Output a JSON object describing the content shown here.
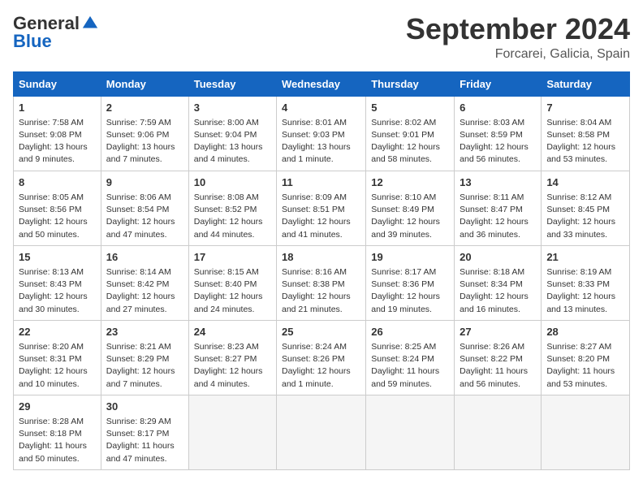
{
  "logo": {
    "general": "General",
    "blue": "Blue"
  },
  "title": "September 2024",
  "subtitle": "Forcarei, Galicia, Spain",
  "days_header": [
    "Sunday",
    "Monday",
    "Tuesday",
    "Wednesday",
    "Thursday",
    "Friday",
    "Saturday"
  ],
  "weeks": [
    [
      {
        "day": "1",
        "info": "Sunrise: 7:58 AM\nSunset: 9:08 PM\nDaylight: 13 hours and 9 minutes."
      },
      {
        "day": "2",
        "info": "Sunrise: 7:59 AM\nSunset: 9:06 PM\nDaylight: 13 hours and 7 minutes."
      },
      {
        "day": "3",
        "info": "Sunrise: 8:00 AM\nSunset: 9:04 PM\nDaylight: 13 hours and 4 minutes."
      },
      {
        "day": "4",
        "info": "Sunrise: 8:01 AM\nSunset: 9:03 PM\nDaylight: 13 hours and 1 minute."
      },
      {
        "day": "5",
        "info": "Sunrise: 8:02 AM\nSunset: 9:01 PM\nDaylight: 12 hours and 58 minutes."
      },
      {
        "day": "6",
        "info": "Sunrise: 8:03 AM\nSunset: 8:59 PM\nDaylight: 12 hours and 56 minutes."
      },
      {
        "day": "7",
        "info": "Sunrise: 8:04 AM\nSunset: 8:58 PM\nDaylight: 12 hours and 53 minutes."
      }
    ],
    [
      {
        "day": "8",
        "info": "Sunrise: 8:05 AM\nSunset: 8:56 PM\nDaylight: 12 hours and 50 minutes."
      },
      {
        "day": "9",
        "info": "Sunrise: 8:06 AM\nSunset: 8:54 PM\nDaylight: 12 hours and 47 minutes."
      },
      {
        "day": "10",
        "info": "Sunrise: 8:08 AM\nSunset: 8:52 PM\nDaylight: 12 hours and 44 minutes."
      },
      {
        "day": "11",
        "info": "Sunrise: 8:09 AM\nSunset: 8:51 PM\nDaylight: 12 hours and 41 minutes."
      },
      {
        "day": "12",
        "info": "Sunrise: 8:10 AM\nSunset: 8:49 PM\nDaylight: 12 hours and 39 minutes."
      },
      {
        "day": "13",
        "info": "Sunrise: 8:11 AM\nSunset: 8:47 PM\nDaylight: 12 hours and 36 minutes."
      },
      {
        "day": "14",
        "info": "Sunrise: 8:12 AM\nSunset: 8:45 PM\nDaylight: 12 hours and 33 minutes."
      }
    ],
    [
      {
        "day": "15",
        "info": "Sunrise: 8:13 AM\nSunset: 8:43 PM\nDaylight: 12 hours and 30 minutes."
      },
      {
        "day": "16",
        "info": "Sunrise: 8:14 AM\nSunset: 8:42 PM\nDaylight: 12 hours and 27 minutes."
      },
      {
        "day": "17",
        "info": "Sunrise: 8:15 AM\nSunset: 8:40 PM\nDaylight: 12 hours and 24 minutes."
      },
      {
        "day": "18",
        "info": "Sunrise: 8:16 AM\nSunset: 8:38 PM\nDaylight: 12 hours and 21 minutes."
      },
      {
        "day": "19",
        "info": "Sunrise: 8:17 AM\nSunset: 8:36 PM\nDaylight: 12 hours and 19 minutes."
      },
      {
        "day": "20",
        "info": "Sunrise: 8:18 AM\nSunset: 8:34 PM\nDaylight: 12 hours and 16 minutes."
      },
      {
        "day": "21",
        "info": "Sunrise: 8:19 AM\nSunset: 8:33 PM\nDaylight: 12 hours and 13 minutes."
      }
    ],
    [
      {
        "day": "22",
        "info": "Sunrise: 8:20 AM\nSunset: 8:31 PM\nDaylight: 12 hours and 10 minutes."
      },
      {
        "day": "23",
        "info": "Sunrise: 8:21 AM\nSunset: 8:29 PM\nDaylight: 12 hours and 7 minutes."
      },
      {
        "day": "24",
        "info": "Sunrise: 8:23 AM\nSunset: 8:27 PM\nDaylight: 12 hours and 4 minutes."
      },
      {
        "day": "25",
        "info": "Sunrise: 8:24 AM\nSunset: 8:26 PM\nDaylight: 12 hours and 1 minute."
      },
      {
        "day": "26",
        "info": "Sunrise: 8:25 AM\nSunset: 8:24 PM\nDaylight: 11 hours and 59 minutes."
      },
      {
        "day": "27",
        "info": "Sunrise: 8:26 AM\nSunset: 8:22 PM\nDaylight: 11 hours and 56 minutes."
      },
      {
        "day": "28",
        "info": "Sunrise: 8:27 AM\nSunset: 8:20 PM\nDaylight: 11 hours and 53 minutes."
      }
    ],
    [
      {
        "day": "29",
        "info": "Sunrise: 8:28 AM\nSunset: 8:18 PM\nDaylight: 11 hours and 50 minutes."
      },
      {
        "day": "30",
        "info": "Sunrise: 8:29 AM\nSunset: 8:17 PM\nDaylight: 11 hours and 47 minutes."
      },
      {
        "day": "",
        "info": ""
      },
      {
        "day": "",
        "info": ""
      },
      {
        "day": "",
        "info": ""
      },
      {
        "day": "",
        "info": ""
      },
      {
        "day": "",
        "info": ""
      }
    ]
  ]
}
